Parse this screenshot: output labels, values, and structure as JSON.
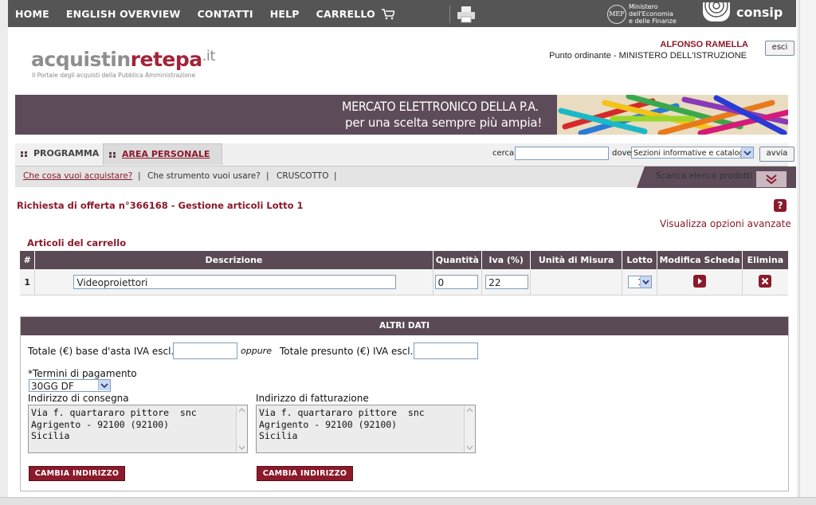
{
  "topnav": {
    "items": [
      "HOME",
      "ENGLISH OVERVIEW",
      "CONTATTI",
      "HELP",
      "CARRELLO"
    ],
    "mef_badge": "MEF",
    "mef_lines": [
      "Ministero",
      "dell'Economia",
      "e delle Finanze"
    ],
    "consip_label": "consip"
  },
  "header": {
    "logo_parts": [
      "acquistin",
      "retepa",
      ".it"
    ],
    "logo_subtitle": "Il Portale degli acquisti della Pubblica Amministrazione",
    "user_name": "ALFONSO RAMELLA",
    "user_role": "Punto ordinante - MINISTERO DELL'ISTRUZIONE",
    "logout_label": "esci"
  },
  "banner": {
    "line1": "MERCATO ELETTRONICO DELLA P.A.",
    "line2": "per una scelta sempre più ampia!"
  },
  "tabs": [
    "PROGRAMMA",
    "AREA PERSONALE"
  ],
  "search": {
    "label": "cerca",
    "value": "",
    "where_label": "dove",
    "where_selected": "Sezioni informative e catalogo",
    "go_label": "avvia"
  },
  "subnav": {
    "links": [
      "Che cosa vuoi acquistare?",
      "Che strumento vuoi usare?",
      "CRUSCOTTO"
    ],
    "download_label": "Scarica elenco prodotti"
  },
  "main": {
    "title": "Richiesta di offerta n°366168 - Gestione articoli Lotto 1",
    "help_symbol": "?",
    "advanced_link": "Visualizza opzioni avanzate",
    "cart_title": "Articoli del carrello",
    "columns": [
      "#",
      "Descrizione",
      "Quantità",
      "Iva (%)",
      "Unità di Misura",
      "Lotto",
      "Modifica Scheda",
      "Elimina"
    ],
    "rows": [
      {
        "num": "1",
        "descrizione": "Videoproiettori",
        "quantita": "0",
        "iva": "22",
        "unita": "",
        "lotto": "1"
      }
    ]
  },
  "altri_dati": {
    "header": "ALTRI DATI",
    "base_asta_label": "Totale (€) base d'asta IVA escl.",
    "base_asta_value": "",
    "oppure": "oppure",
    "presunto_label": "Totale presunto (€) IVA escl.",
    "presunto_value": "",
    "termini_label": "*Termini di pagamento",
    "termini_value": "30GG DF",
    "consegna_label": "Indirizzo di consegna",
    "consegna_lines": [
      "Via f. quartararo pittore  snc",
      "Agrigento - 92100 (92100)",
      "Sicilia"
    ],
    "fatturazione_label": "Indirizzo di fatturazione",
    "fatturazione_lines": [
      "Via f. quartararo pittore  snc",
      "Agrigento - 92100 (92100)",
      "Sicilia"
    ],
    "change_button": "CAMBIA INDIRIZZO"
  },
  "colors": {
    "nav_bg": "#555555",
    "accent": "#8b1a2b",
    "header_purple": "#5a4a55",
    "banner_bg": "#5e4b59"
  }
}
